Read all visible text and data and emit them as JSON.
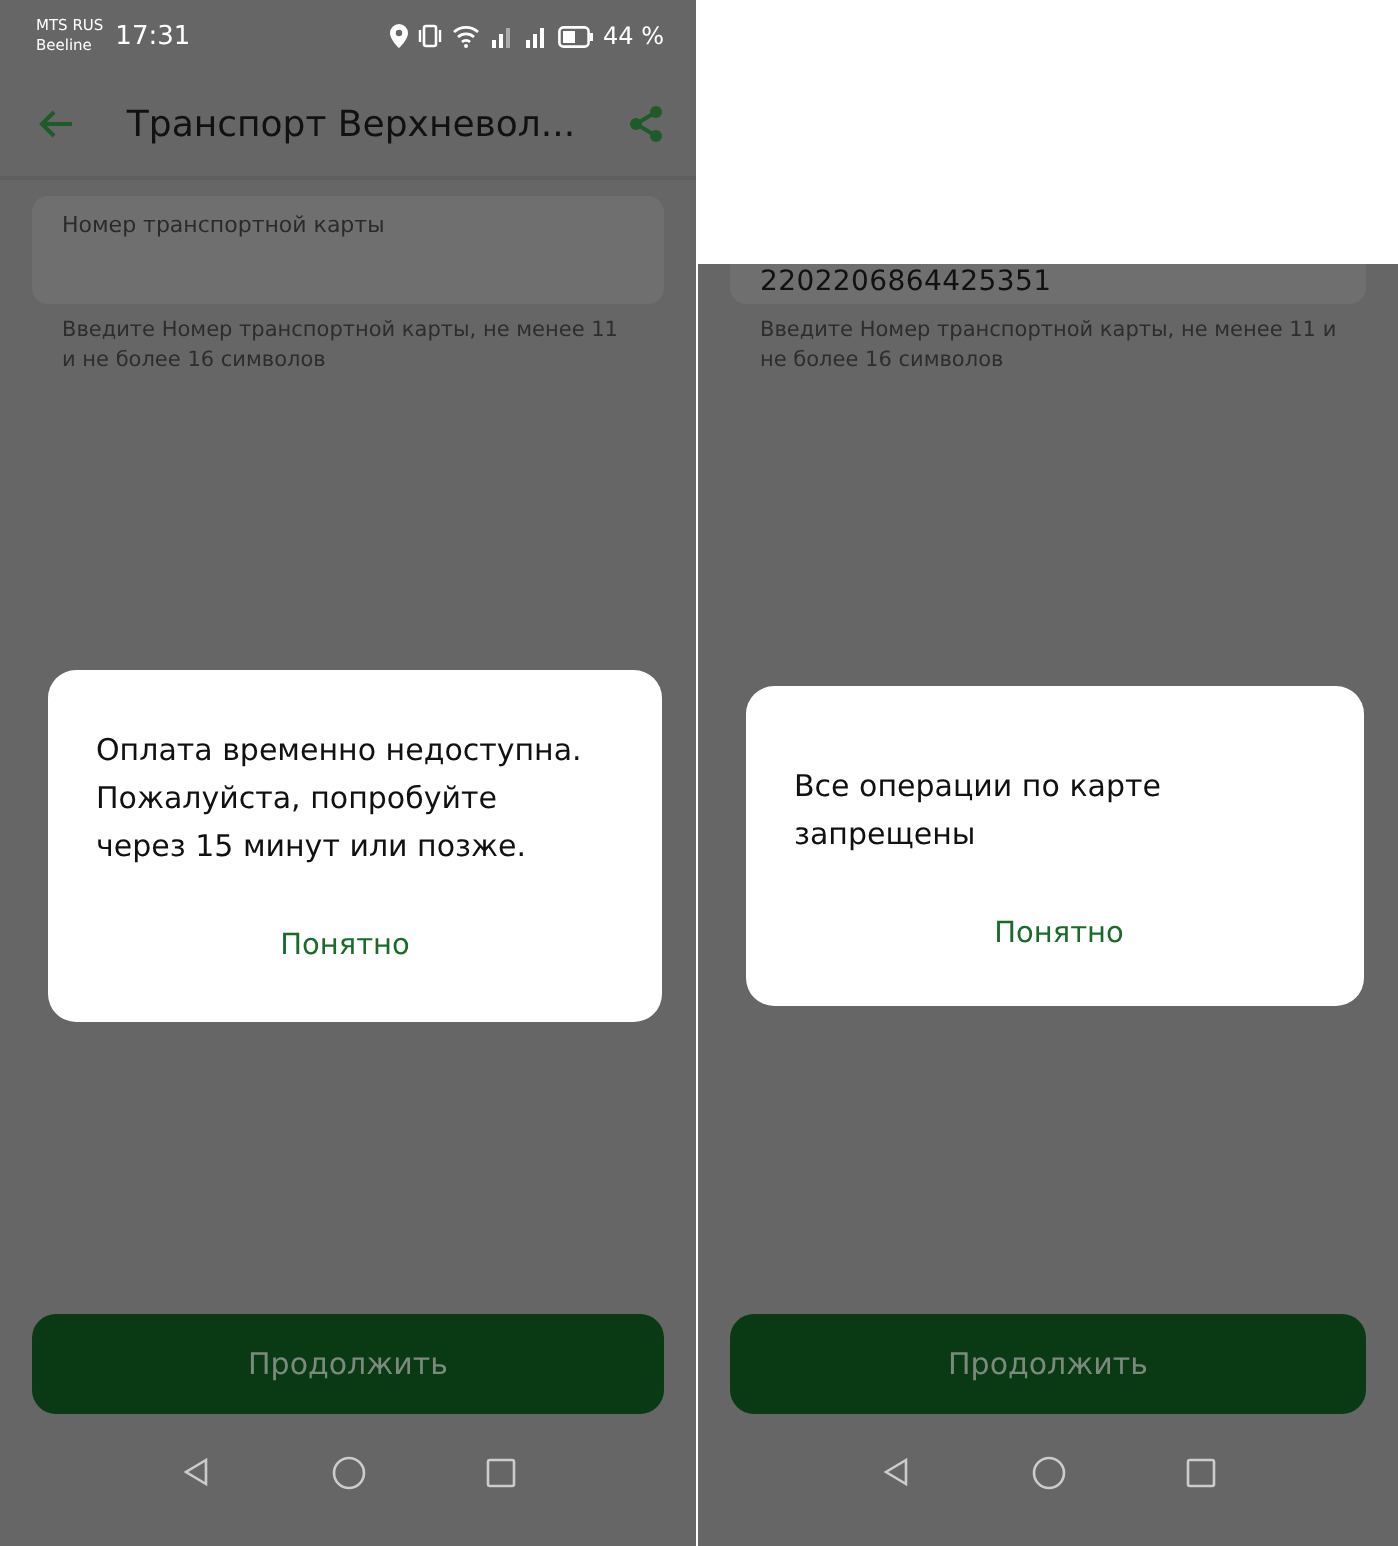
{
  "screens": [
    {
      "status_bar": {
        "carriers": [
          "MTS RUS",
          "Beeline"
        ],
        "time": "17:31",
        "battery": "44 %"
      },
      "header": {
        "title": "Транспорт Верхневол..."
      },
      "field": {
        "label": "Номер транспортной карты"
      },
      "hint": "Введите Номер транспортной карты, не менее 11 и не более 16 символов",
      "dialog": {
        "message": "Оплата временно недоступна. Пожалуйста, попробуйте через 15 минут или позже.",
        "button": "Понятно"
      },
      "continue_button": {
        "label": "Продолжить",
        "disabled": true
      }
    },
    {
      "cover": true,
      "field": {
        "value": "2202206864425351"
      },
      "hint": "Введите Номер транспортной карты, не менее 11 и не более 16 символов",
      "dialog": {
        "message": "Все операции по карте запрещены",
        "button": "Понятно"
      },
      "continue_button": {
        "label": "Продолжить",
        "disabled": true
      }
    }
  ]
}
